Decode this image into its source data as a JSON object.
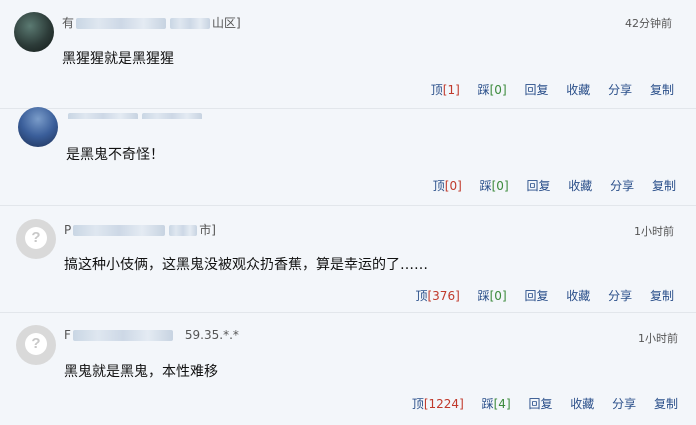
{
  "comments": [
    {
      "user_visible": "有",
      "location": "山区]",
      "time": "42分钟前",
      "text": "黑猩猩就是黑猩猩",
      "up_label": "顶",
      "up_count": "1",
      "down_label": "踩",
      "down_count": "0",
      "reply": "回复",
      "collect": "收藏",
      "share": "分享",
      "copy": "复制"
    },
    {
      "user_visible": "",
      "location": "",
      "time": "",
      "text": "是黑鬼不奇怪！",
      "up_label": "顶",
      "up_count": "0",
      "down_label": "踩",
      "down_count": "0",
      "reply": "回复",
      "collect": "收藏",
      "share": "分享",
      "copy": "复制"
    },
    {
      "user_visible": "P",
      "location": "市]",
      "time": "1小时前",
      "text": "搞这种小伎俩，这黑鬼没被观众扔香蕉，算是幸运的了……",
      "up_label": "顶",
      "up_count": "376",
      "down_label": "踩",
      "down_count": "0",
      "reply": "回复",
      "collect": "收藏",
      "share": "分享",
      "copy": "复制"
    },
    {
      "user_visible": "F",
      "location": "59.35.*.*",
      "time": "1小时前",
      "text": "黑鬼就是黑鬼，本性难移",
      "up_label": "顶",
      "up_count": "1224",
      "down_label": "踩",
      "down_count": "4",
      "reply": "回复",
      "collect": "收藏",
      "share": "分享",
      "copy": "复制"
    }
  ],
  "colors": {
    "link": "#2a4f8a",
    "up_count": "#c0392b",
    "down_count": "#3b8a3b",
    "background": "#f3f6fa"
  }
}
